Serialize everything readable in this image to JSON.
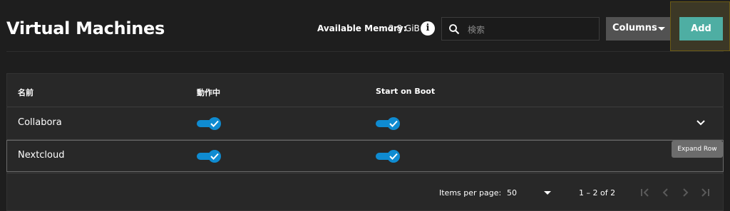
{
  "header": {
    "title": "Virtual Machines",
    "memory_label": "Available Memory:",
    "memory_value": "2.8 GiB",
    "search_placeholder": "検索",
    "columns_label": "Columns",
    "add_label": "Add"
  },
  "table": {
    "columns": [
      "名前",
      "動作中",
      "Start on Boot"
    ],
    "rows": [
      {
        "name": "Collabora",
        "running": true,
        "start_on_boot": true
      },
      {
        "name": "Nextcloud",
        "running": true,
        "start_on_boot": true
      }
    ],
    "expand_tooltip": "Expand Row"
  },
  "pagination": {
    "items_per_page_label": "Items per page:",
    "items_per_page": "50",
    "range": "1 – 2 of 2"
  },
  "colors": {
    "accent": "#4eaea3",
    "toggle_on": "#0f8bd1",
    "background": "#1e1e1e",
    "card": "#282828"
  },
  "icons": {
    "info": "info-icon",
    "search": "search-icon",
    "caret": "caret-down-icon",
    "expand": "chevron-down-icon",
    "first": "first-page-icon",
    "prev": "previous-page-icon",
    "next": "next-page-icon",
    "last": "last-page-icon"
  }
}
